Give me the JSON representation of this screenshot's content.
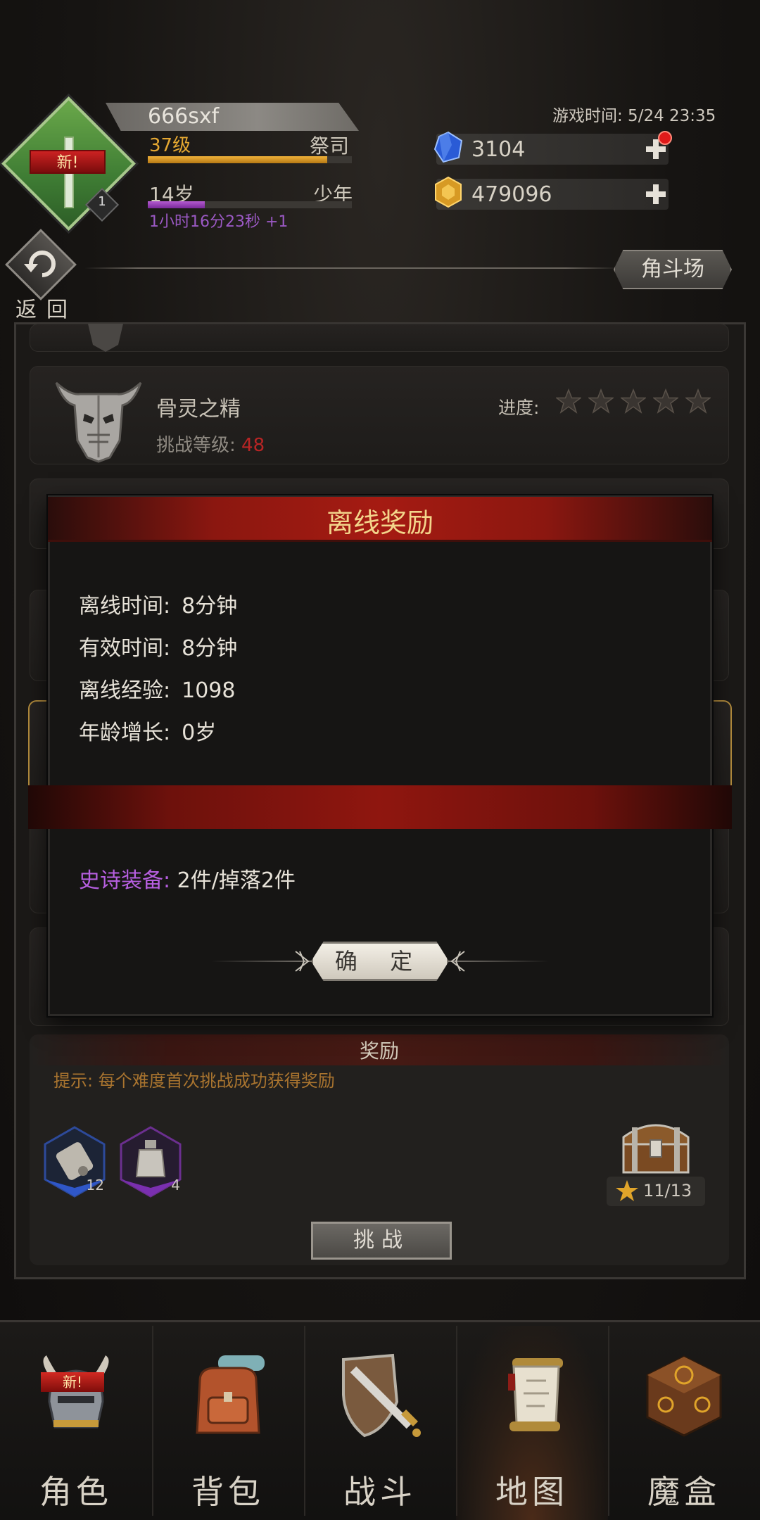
{
  "header": {
    "status_ghost": "",
    "player_name": "666sxf",
    "level": "37级",
    "class": "祭司",
    "xp_progress": 0.88,
    "age": "14岁",
    "age_stage": "少年",
    "age_progress": 0.28,
    "age_timer": "1小时16分23秒 +1",
    "avatar_badge": "新!",
    "avatar_level": "1",
    "game_time": "游戏时间: 5/24 23:35",
    "gems": "3104",
    "gold": "479096",
    "back_label": "返回",
    "arena_label": "角斗场"
  },
  "list": {
    "boss_name": "骨灵之精",
    "challenge_label": "挑战等级:",
    "challenge_level": "48",
    "progress_label": "进度:",
    "stars_total": 5,
    "stars_filled": 0
  },
  "reward": {
    "title": "奖励",
    "tip": "提示: 每个难度首次挑战成功获得奖励",
    "items": [
      {
        "icon": "scroll-icon",
        "count": "12",
        "rarity": "blue"
      },
      {
        "icon": "bottle-icon",
        "count": "4",
        "rarity": "purple"
      }
    ],
    "chest_score": "11/13",
    "fight_label": "挑战"
  },
  "modal": {
    "title": "离线奖励",
    "offline_time_label": "离线时间:",
    "offline_time": "8分钟",
    "effective_time_label": "有效时间:",
    "effective_time": "8分钟",
    "offline_exp_label": "离线经验:",
    "offline_exp": "1098",
    "age_growth_label": "年龄增长:",
    "age_growth": "0岁",
    "epic_label": "史诗装备:",
    "epic_value": "2件/掉落2件",
    "confirm_label": "确 定"
  },
  "nav": {
    "active_index": 3,
    "items": [
      {
        "label": "角色",
        "icon": "helmet-icon",
        "badge": "新!"
      },
      {
        "label": "背包",
        "icon": "backpack-icon"
      },
      {
        "label": "战斗",
        "icon": "sword-shield-icon"
      },
      {
        "label": "地图",
        "icon": "map-scroll-icon"
      },
      {
        "label": "魔盒",
        "icon": "magic-box-icon"
      }
    ]
  },
  "colors": {
    "accent_red": "#a51b12",
    "gold_text": "#f3d58b",
    "epic_purple": "#b65fe0",
    "xp_orange": "#e5a832"
  }
}
